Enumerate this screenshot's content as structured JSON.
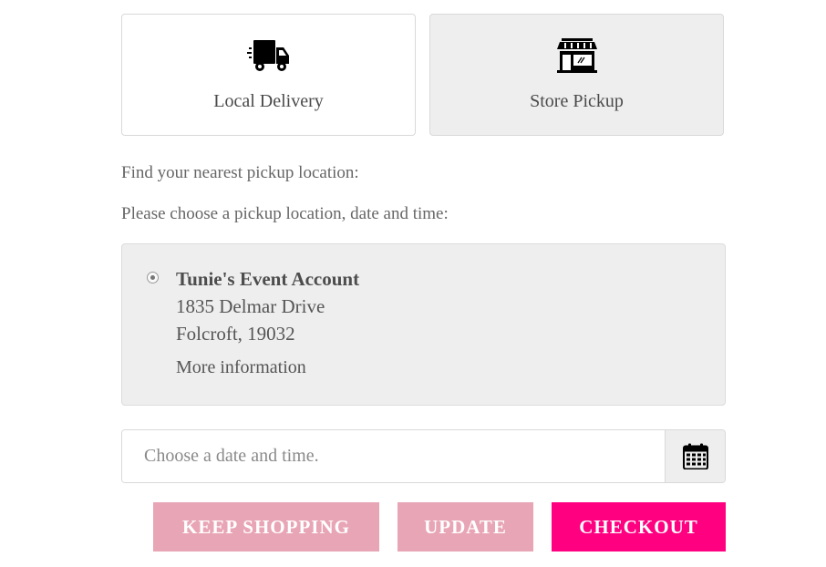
{
  "methods": {
    "delivery": {
      "label": "Local Delivery",
      "icon": "delivery-truck-icon"
    },
    "pickup": {
      "label": "Store Pickup",
      "icon": "storefront-icon",
      "selected": true
    }
  },
  "prompts": {
    "find": "Find your nearest pickup location:",
    "choose": "Please choose a pickup location, date and time:"
  },
  "location": {
    "name": "Tunie's Event Account",
    "address_line1": "1835 Delmar Drive",
    "address_line2": "Folcroft, 19032",
    "more_info": "More information",
    "selected": true
  },
  "date_picker": {
    "placeholder": "Choose a date and time.",
    "value": "",
    "icon": "calendar-icon"
  },
  "buttons": {
    "keep_shopping": "KEEP SHOPPING",
    "update": "UPDATE",
    "checkout": "CHECKOUT"
  },
  "colors": {
    "checkout_bg": "#ff0080",
    "secondary_btn_bg": "#e8a5b5",
    "selected_card_bg": "#eeeeee"
  }
}
